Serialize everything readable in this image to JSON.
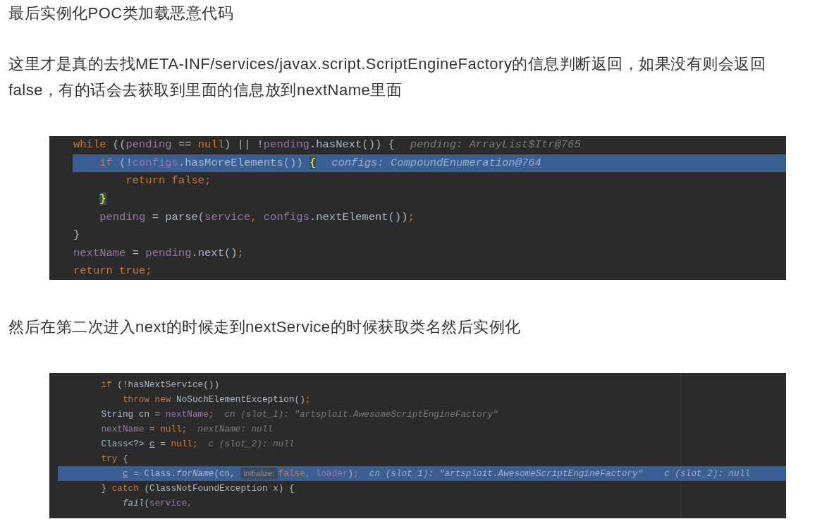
{
  "content": [
    {
      "kind": "paragraph",
      "text": "最后实例化POC类加载恶意代码"
    },
    {
      "kind": "paragraph",
      "text": "这里才是真的去找META-INF/services/javax.script.ScriptEngineFactory的信息判断返回，如果没有则会返回false，有的话会去获取到里面的信息放到nextName里面"
    },
    {
      "kind": "code",
      "lines": [
        {
          "highlighted": false,
          "tokens": [
            {
              "text": "while",
              "kind": "keyword"
            },
            {
              "text": " ((",
              "kind": "plain"
            },
            {
              "text": "pending",
              "kind": "field"
            },
            {
              "text": " == ",
              "kind": "plain"
            },
            {
              "text": "null",
              "kind": "keyword"
            },
            {
              "text": ") || !",
              "kind": "plain"
            },
            {
              "text": "pending",
              "kind": "field"
            },
            {
              "text": ".hasNext()) {",
              "kind": "plain"
            },
            {
              "text": "pending: ArrayList$Itr@765",
              "kind": "hint"
            }
          ]
        },
        {
          "highlighted": true,
          "tokens": [
            {
              "text": "    if",
              "kind": "keyword"
            },
            {
              "text": " (!",
              "kind": "plain"
            },
            {
              "text": "configs",
              "kind": "field"
            },
            {
              "text": ".hasMoreElements()) ",
              "kind": "plain"
            },
            {
              "text": "{",
              "kind": "match"
            },
            {
              "text": "configs: CompoundEnumeration@764",
              "kind": "hint"
            }
          ]
        },
        {
          "highlighted": false,
          "tokens": [
            {
              "text": "        return false;",
              "kind": "keyword"
            }
          ]
        },
        {
          "highlighted": false,
          "tokens": [
            {
              "text": "    }",
              "kind": "match"
            }
          ]
        },
        {
          "highlighted": false,
          "tokens": [
            {
              "text": "    pending",
              "kind": "field"
            },
            {
              "text": " = parse(",
              "kind": "plain"
            },
            {
              "text": "service",
              "kind": "field"
            },
            {
              "text": ", ",
              "kind": "keyword"
            },
            {
              "text": "configs",
              "kind": "field"
            },
            {
              "text": ".nextElement())",
              "kind": "plain"
            },
            {
              "text": ";",
              "kind": "keyword"
            }
          ]
        },
        {
          "highlighted": false,
          "tokens": [
            {
              "text": "}",
              "kind": "plain"
            }
          ]
        },
        {
          "highlighted": false,
          "tokens": [
            {
              "text": "nextName",
              "kind": "field"
            },
            {
              "text": " = ",
              "kind": "plain"
            },
            {
              "text": "pending",
              "kind": "field"
            },
            {
              "text": ".next()",
              "kind": "plain"
            },
            {
              "text": ";",
              "kind": "keyword"
            }
          ]
        },
        {
          "highlighted": false,
          "tokens": [
            {
              "text": "return true;",
              "kind": "keyword"
            }
          ]
        }
      ]
    },
    {
      "kind": "paragraph",
      "text": "然后在第二次进入next的时候走到nextService的时候获取类名然后实例化"
    },
    {
      "kind": "code",
      "lines": [
        {
          "highlighted": false,
          "tokens": [
            {
              "text": "    if",
              "kind": "keyword"
            },
            {
              "text": " (!hasNextService())",
              "kind": "plain"
            }
          ]
        },
        {
          "highlighted": false,
          "tokens": [
            {
              "text": "        throw new",
              "kind": "keyword"
            },
            {
              "text": " NoSuchElementException()",
              "kind": "plain"
            },
            {
              "text": ";",
              "kind": "keyword"
            }
          ]
        },
        {
          "highlighted": false,
          "tokens": [
            {
              "text": "    String cn = ",
              "kind": "plain"
            },
            {
              "text": "nextName",
              "kind": "field"
            },
            {
              "text": ";",
              "kind": "keyword"
            },
            {
              "text": "cn (slot_1): \"artsploit.AwesomeScriptEngineFactory\"",
              "kind": "hint"
            }
          ]
        },
        {
          "highlighted": false,
          "tokens": [
            {
              "text": "    nextName",
              "kind": "field"
            },
            {
              "text": " = ",
              "kind": "plain"
            },
            {
              "text": "null;",
              "kind": "keyword"
            },
            {
              "text": "nextName: null",
              "kind": "hint"
            }
          ]
        },
        {
          "highlighted": false,
          "tokens": [
            {
              "text": "    Class<?> ",
              "kind": "plain"
            },
            {
              "text": "c",
              "kind": "underlined"
            },
            {
              "text": " = ",
              "kind": "plain"
            },
            {
              "text": "null;",
              "kind": "keyword"
            },
            {
              "text": "c (slot_2): null",
              "kind": "hint"
            }
          ]
        },
        {
          "highlighted": false,
          "tokens": [
            {
              "text": "    try",
              "kind": "keyword"
            },
            {
              "text": " {",
              "kind": "plain"
            }
          ]
        },
        {
          "highlighted": true,
          "tokens": [
            {
              "text": "        c",
              "kind": "underlined"
            },
            {
              "text": " = Class.",
              "kind": "plain"
            },
            {
              "text": "forName",
              "kind": "italic"
            },
            {
              "text": "(cn, ",
              "kind": "plain"
            },
            {
              "text": "initialize:",
              "kind": "inlay"
            },
            {
              "text": "false, ",
              "kind": "keyword"
            },
            {
              "text": "loader",
              "kind": "field"
            },
            {
              "text": ")",
              "kind": "plain"
            },
            {
              "text": ";",
              "kind": "keyword"
            },
            {
              "text": "cn (slot_1): \"artsploit.AwesomeScriptEngineFactory\"",
              "kind": "hint"
            },
            {
              "text": "c (slot_2): null",
              "kind": "hint"
            }
          ]
        },
        {
          "highlighted": false,
          "tokens": [
            {
              "text": "    } ",
              "kind": "plain"
            },
            {
              "text": "catch",
              "kind": "keyword"
            },
            {
              "text": " (ClassNotFoundException x) {",
              "kind": "plain"
            }
          ]
        },
        {
          "highlighted": false,
          "tokens": [
            {
              "text": "        fail",
              "kind": "italic"
            },
            {
              "text": "(",
              "kind": "plain"
            },
            {
              "text": "service",
              "kind": "field"
            },
            {
              "text": ",",
              "kind": "keyword"
            }
          ]
        }
      ]
    }
  ]
}
